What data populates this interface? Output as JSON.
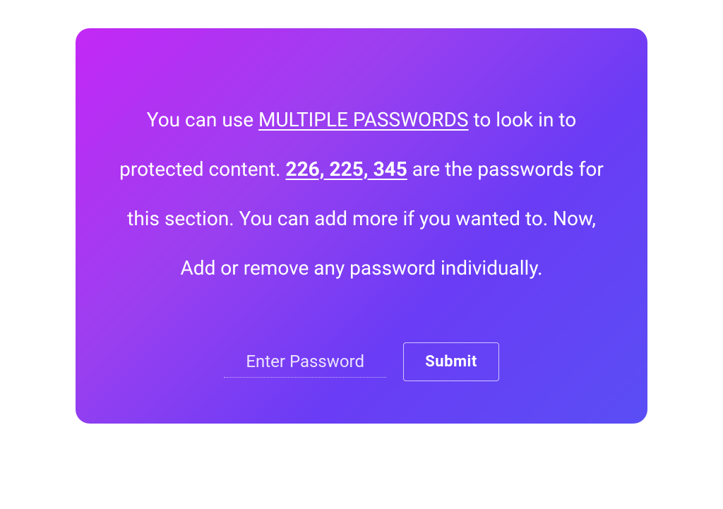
{
  "card": {
    "message": {
      "part1": "You can use ",
      "emphasis1": "MULTIPLE PASSWORDS",
      "part2": " to look in to protected content. ",
      "emphasis2": "226, 225, 345",
      "part3": " are the passwords for this section. You can add more if you wanted to. Now, Add or remove any password individually."
    },
    "form": {
      "password_placeholder": "Enter Password",
      "submit_label": "Submit"
    }
  }
}
